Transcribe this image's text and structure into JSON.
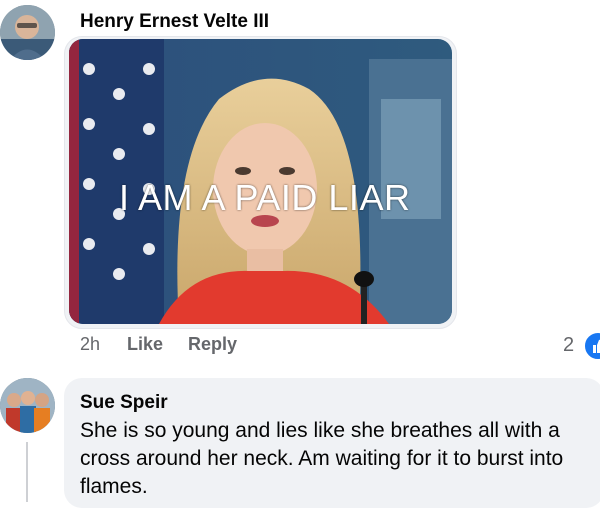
{
  "comment1": {
    "author": "Henry Ernest Velte III",
    "image_caption": "I AM A PAID LIAR",
    "time": "2h",
    "like_label": "Like",
    "reply_label": "Reply",
    "reaction_count": "2",
    "reaction_icon": "thumbs-up-icon"
  },
  "comment2": {
    "author": "Sue Speir",
    "text": "She is so young and lies like she breathes all with a cross around her neck. Am waiting for it to burst into flames."
  },
  "colors": {
    "accent": "#1877f2",
    "bubble": "#f0f2f5",
    "meta_text": "#65676b",
    "body_text": "#050505"
  }
}
